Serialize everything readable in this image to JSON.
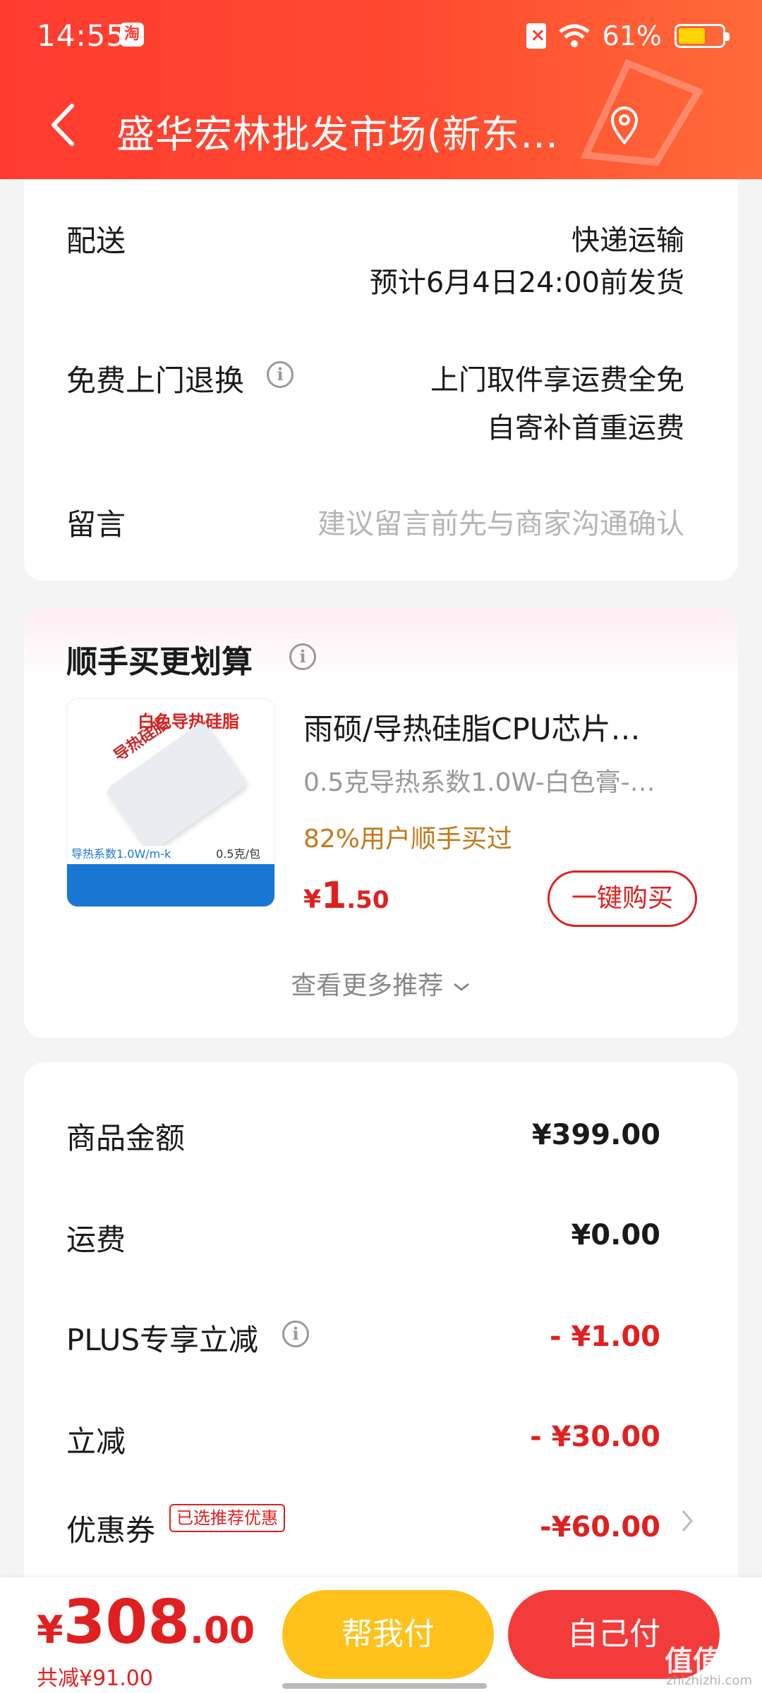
{
  "status_bar": {
    "time": "14:55",
    "app_badge": "淘",
    "battery_pct": "61%",
    "battery_level": 0.61
  },
  "header": {
    "title": "盛华宏林批发市场(新东…"
  },
  "delivery": {
    "shipping_label": "配送",
    "shipping_method": "快递运输",
    "shipping_eta": "预计6月4日24:00前发货",
    "return_label": "免费上门退换",
    "return_line1": "上门取件享运费全免",
    "return_line2": "自寄补首重运费",
    "message_label": "留言",
    "message_placeholder": "建议留言前先与商家沟通确认"
  },
  "recommend": {
    "title": "顺手买更划算",
    "product_name": "雨硕/导热硅脂CPU芯片…",
    "product_spec": "0.5克导热系数1.0W-白色膏-…",
    "product_tip": "82%用户顺手买过",
    "price_symbol": "¥",
    "price_int": "1",
    "price_dec": ".50",
    "buy_label": "一键购买",
    "more_label": "查看更多推荐",
    "thumb": {
      "top_text": "白色导热硅脂",
      "packet_text": "导热硅脂",
      "bottom_left": "导热系数1.0W/m-k",
      "bottom_right": "0.5克/包"
    }
  },
  "summary": {
    "goods_label": "商品金额",
    "goods_value": "¥399.00",
    "freight_label": "运费",
    "freight_value": "¥0.00",
    "plus_label": "PLUS专享立减",
    "plus_value": "- ¥1.00",
    "discount_label": "立减",
    "discount_value": "- ¥30.00",
    "coupon_label": "优惠券",
    "coupon_badge": "已选推荐优惠",
    "coupon_value": "-¥60.00"
  },
  "bottom": {
    "total_symbol": "¥",
    "total_int": "308",
    "total_dec": ".00",
    "saved": "共减¥91.00",
    "pay_friend": "帮我付",
    "pay_self": "自己付",
    "watermark": "值值值",
    "watermark_sub": "zhizhizhi.com"
  },
  "colors": {
    "brand_red": "#ff3b30",
    "price_red": "#e02020",
    "tip_orange": "#c27a1b",
    "friend_pay_yellow": "#ffc21a"
  },
  "icons": [
    "back-arrow-icon",
    "location-pin-icon",
    "info-icon",
    "chevron-down-icon",
    "chevron-right-icon",
    "wifi-icon",
    "battery-icon",
    "sim-icon"
  ]
}
